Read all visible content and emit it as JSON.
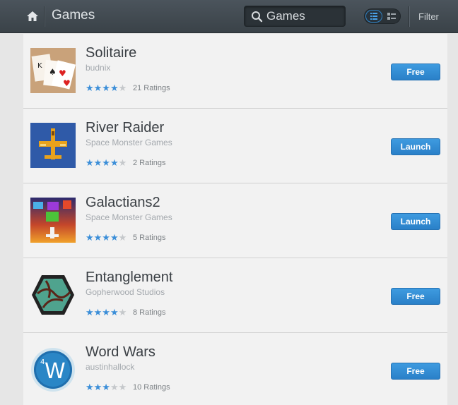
{
  "header": {
    "title": "Games",
    "search_value": "Games",
    "filter_label": "Filter"
  },
  "apps": [
    {
      "name": "Solitaire",
      "developer": "budnix",
      "rating": 4,
      "ratings_label": "21 Ratings",
      "button": "Free",
      "icon": "solitaire-icon"
    },
    {
      "name": "River Raider",
      "developer": "Space Monster Games",
      "rating": 4,
      "ratings_label": "2 Ratings",
      "button": "Launch",
      "icon": "river-raider-icon"
    },
    {
      "name": "Galactians2",
      "developer": "Space Monster Games",
      "rating": 4,
      "ratings_label": "5 Ratings",
      "button": "Launch",
      "icon": "galactians-icon"
    },
    {
      "name": "Entanglement",
      "developer": "Gopherwood Studios",
      "rating": 4,
      "ratings_label": "8 Ratings",
      "button": "Free",
      "icon": "entanglement-icon"
    },
    {
      "name": "Word Wars",
      "developer": "austinhallock",
      "rating": 3,
      "ratings_label": "10 Ratings",
      "button": "Free",
      "icon": "word-wars-icon"
    }
  ],
  "colors": {
    "accent": "#3b8ed8",
    "topbar": "#434b52"
  }
}
